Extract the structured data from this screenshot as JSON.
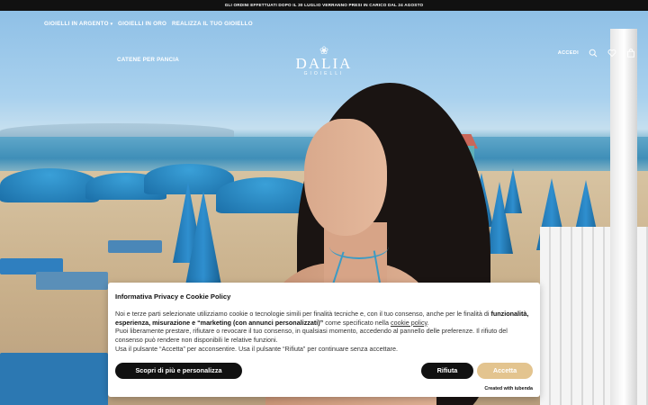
{
  "announcement": "GLI ORDINI EFFETTUATI DOPO IL 30 LUGLIO VERRANNO PRESI IN CARICO DAL 24 AGOSTO",
  "nav": {
    "items": [
      {
        "label": "GIOIELLI IN ARGENTO"
      },
      {
        "label": "GIOIELLI IN ORO"
      },
      {
        "label": "REALIZZA IL TUO GIOIELLO"
      },
      {
        "label": "CATENE PER PANCIA"
      }
    ],
    "login_label": "ACCEDI"
  },
  "brand": {
    "name": "DALIA",
    "tagline": "GIOIELLI"
  },
  "icons": [
    "search-icon",
    "heart-icon",
    "bag-icon",
    "flower-logo-icon",
    "chevron-down-icon"
  ],
  "cookie_banner": {
    "title": "Informativa Privacy e Cookie Policy",
    "line1_start": "Noi e terze parti selezionate utilizziamo cookie o tecnologie simili per finalità tecniche e, con il tuo consenso, anche per le finalità di ",
    "line1_bold": "funzionalità, esperienza, misurazione e “marketing (con annunci personalizzati)”",
    "line1_mid": " come specificato nella ",
    "cookie_policy_link": "cookie policy",
    "line1_end": ".",
    "line2": "Puoi liberamente prestare, rifiutare o revocare il tuo consenso, in qualsiasi momento, accedendo al pannello delle preferenze. Il rifiuto del consenso può rendere non disponibili le relative funzioni.",
    "line3": "Usa il pulsante “Accetta” per acconsentire. Usa il pulsante “Rifiuta” per continuare senza accettare.",
    "more_button": "Scopri di più e personalizza",
    "reject_button": "Rifiuta",
    "accept_button": "Accetta",
    "powered_by": "Created with iubenda"
  },
  "colors": {
    "accept": "#e3c48f",
    "dark_button": "#111111",
    "announcement_bg": "#111111"
  }
}
